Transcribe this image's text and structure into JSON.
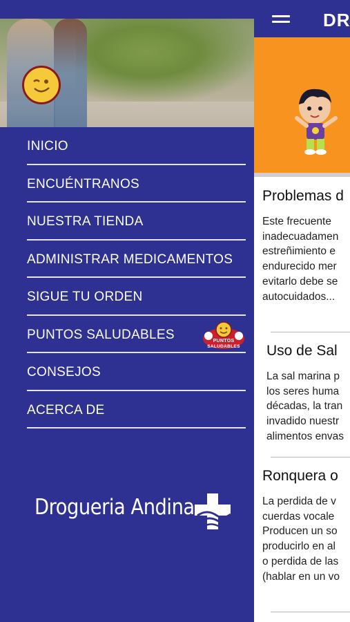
{
  "app": {
    "title": "DRO"
  },
  "menu": {
    "items": [
      {
        "label": "INICIO"
      },
      {
        "label": "ENCUÉNTRANOS"
      },
      {
        "label": "NUESTRA TIENDA"
      },
      {
        "label": "ADMINISTRAR MEDICAMENTOS"
      },
      {
        "label": "SIGUE TU ORDEN"
      },
      {
        "label": "PUNTOS SALUDABLES"
      },
      {
        "label": "CONSEJOS"
      },
      {
        "label": "ACERCA DE"
      }
    ],
    "badge_text": "PUNTOS SALUDABLES"
  },
  "brand": {
    "logo_text": "Drogueria Andina"
  },
  "articles": [
    {
      "title": "Problemas d",
      "body": "Este frecuente\ninadecuadamen\nestreñimiento e\nendurecido mer\nevitarlo debe se\nautocuidados..."
    },
    {
      "title": "Uso de Sal",
      "body": "La sal marina p\nlos seres huma\ndécadas, la tran\ninvadido nuestr\nalimentos envas"
    },
    {
      "title": "Ronquera o",
      "body": "La perdida de v\ncuerdas vocale\nProducen un so\nproducirlo en al\no perdida de las\n(hablar en un vo"
    }
  ],
  "colors": {
    "primary": "#2e3192",
    "banner": "#f7931e",
    "smiley": "#f6c93b"
  }
}
